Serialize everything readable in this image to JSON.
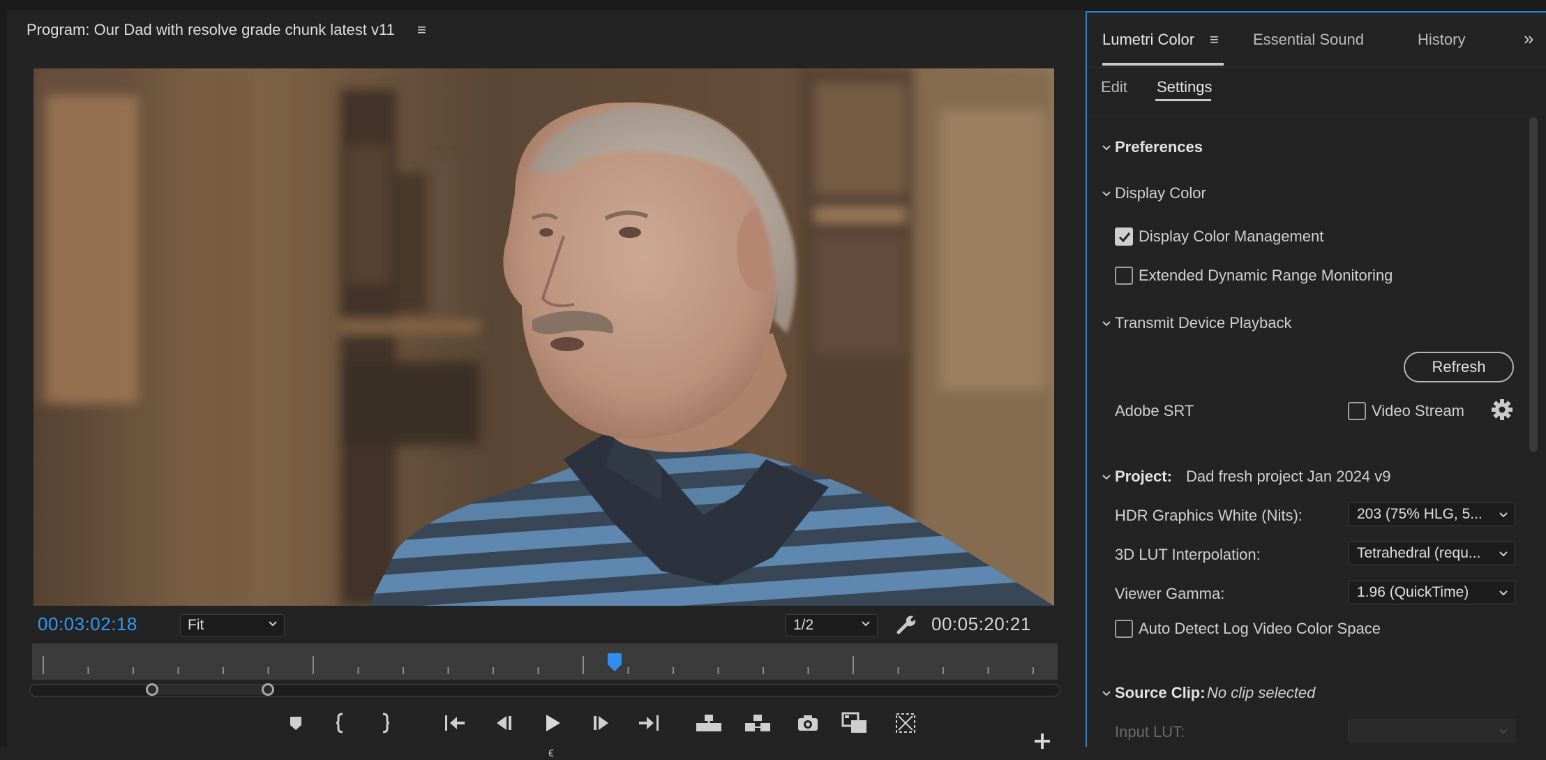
{
  "program": {
    "title": "Program: Our Dad with resolve grade chunk  latest v11",
    "menu_glyph": "≡",
    "current_timecode": "00:03:02:18",
    "duration_timecode": "00:05:20:21",
    "zoom_select": "Fit",
    "resolution_select": "1/2",
    "marker_glyph": "ϵ"
  },
  "panel": {
    "tabs": [
      {
        "label": "Lumetri Color"
      },
      {
        "label": "Essential Sound"
      },
      {
        "label": "History"
      }
    ],
    "tab_menu_glyph": "≡",
    "overflow_glyph": "»",
    "subtabs": [
      {
        "label": "Edit"
      },
      {
        "label": "Settings"
      }
    ],
    "preferences": {
      "header": "Preferences",
      "display_color": {
        "header": "Display Color",
        "display_color_management": {
          "label": "Display Color Management",
          "checked": true
        },
        "extended_dynamic_range": {
          "label": "Extended Dynamic Range Monitoring",
          "checked": false
        }
      },
      "transmit": {
        "header": "Transmit Device Playback",
        "refresh_label": "Refresh",
        "device_name": "Adobe SRT",
        "video_stream": {
          "label": "Video Stream",
          "checked": false
        }
      }
    },
    "project": {
      "label": "Project:",
      "name": "Dad fresh project Jan 2024 v9",
      "hdr_white": {
        "label": "HDR Graphics White (Nits):",
        "value": "203 (75% HLG, 5..."
      },
      "lut_interp": {
        "label": "3D LUT Interpolation:",
        "value": "Tetrahedral (requ..."
      },
      "viewer_gamma": {
        "label": "Viewer Gamma:",
        "value": "1.96 (QuickTime)"
      },
      "auto_detect": {
        "label": "Auto Detect Log Video Color Space",
        "checked": false
      }
    },
    "source_clip": {
      "label": "Source Clip:",
      "value": "No clip selected",
      "input_lut_label": "Input LUT:"
    }
  },
  "colors": {
    "accent_blue": "#2f9bf5",
    "panel_focus_border": "#2a84d8",
    "background": "#232323"
  }
}
